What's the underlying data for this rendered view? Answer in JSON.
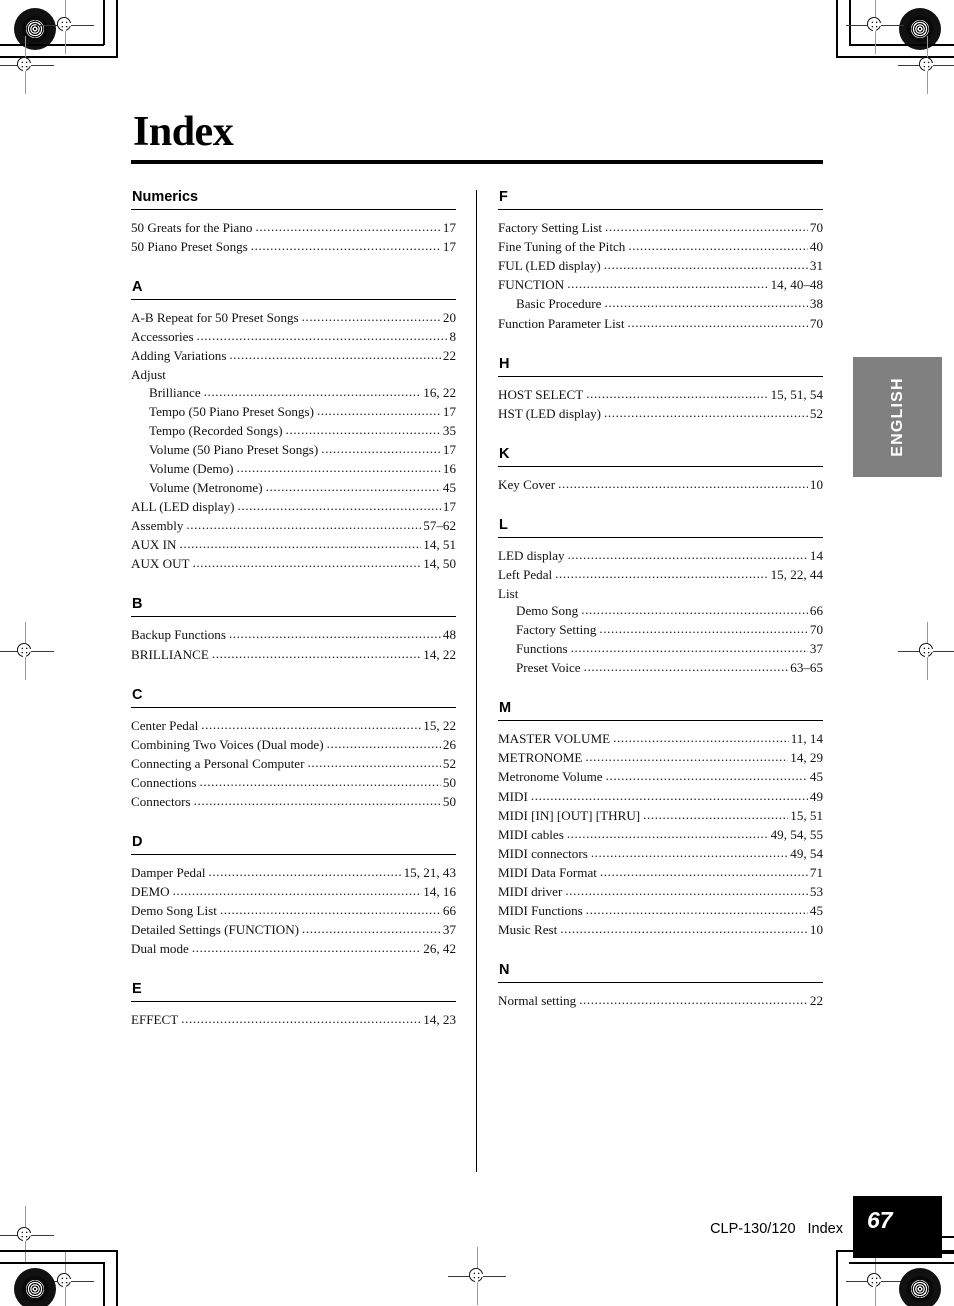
{
  "document": {
    "title": "Index",
    "language_tab": "ENGLISH",
    "footer": {
      "model": "CLP-130/120",
      "section": "Index",
      "page_number": "67"
    }
  },
  "columns": [
    {
      "id": "left",
      "sections": [
        {
          "letter": "Numerics",
          "entries": [
            {
              "text": "50 Greats for the Piano",
              "page": "17",
              "sub": false
            },
            {
              "text": "50 Piano Preset Songs",
              "page": "17",
              "sub": false
            }
          ]
        },
        {
          "letter": "A",
          "entries": [
            {
              "text": "A-B Repeat for 50 Preset Songs",
              "page": "20",
              "sub": false
            },
            {
              "text": "Accessories",
              "page": "8",
              "sub": false
            },
            {
              "text": "Adding Variations",
              "page": "22",
              "sub": false
            },
            {
              "text": "Adjust",
              "page": "",
              "sub": false
            },
            {
              "text": "Brilliance",
              "page": "16, 22",
              "sub": true
            },
            {
              "text": "Tempo (50 Piano Preset Songs)",
              "page": "17",
              "sub": true
            },
            {
              "text": "Tempo (Recorded Songs)",
              "page": "35",
              "sub": true
            },
            {
              "text": "Volume (50 Piano Preset Songs)",
              "page": "17",
              "sub": true
            },
            {
              "text": "Volume (Demo)",
              "page": "16",
              "sub": true
            },
            {
              "text": "Volume (Metronome)",
              "page": "45",
              "sub": true
            },
            {
              "text": "ALL (LED display)",
              "page": "17",
              "sub": false
            },
            {
              "text": "Assembly",
              "page": "57–62",
              "sub": false
            },
            {
              "text": "AUX IN",
              "page": "14, 51",
              "sub": false
            },
            {
              "text": "AUX OUT",
              "page": "14, 50",
              "sub": false
            }
          ]
        },
        {
          "letter": "B",
          "entries": [
            {
              "text": "Backup Functions",
              "page": "48",
              "sub": false
            },
            {
              "text": "BRILLIANCE",
              "page": "14, 22",
              "sub": false
            }
          ]
        },
        {
          "letter": "C",
          "entries": [
            {
              "text": "Center Pedal",
              "page": "15, 22",
              "sub": false
            },
            {
              "text": "Combining Two Voices (Dual mode)",
              "page": "26",
              "sub": false
            },
            {
              "text": "Connecting a Personal Computer",
              "page": "52",
              "sub": false
            },
            {
              "text": "Connections",
              "page": "50",
              "sub": false
            },
            {
              "text": "Connectors",
              "page": "50",
              "sub": false
            }
          ]
        },
        {
          "letter": "D",
          "entries": [
            {
              "text": "Damper Pedal",
              "page": "15, 21, 43",
              "sub": false
            },
            {
              "text": "DEMO",
              "page": "14, 16",
              "sub": false
            },
            {
              "text": "Demo Song List",
              "page": "66",
              "sub": false
            },
            {
              "text": "Detailed Settings (FUNCTION)",
              "page": "37",
              "sub": false
            },
            {
              "text": "Dual mode",
              "page": "26, 42",
              "sub": false
            }
          ]
        },
        {
          "letter": "E",
          "entries": [
            {
              "text": "EFFECT",
              "page": "14, 23",
              "sub": false
            }
          ]
        }
      ]
    },
    {
      "id": "right",
      "sections": [
        {
          "letter": "F",
          "entries": [
            {
              "text": "Factory Setting List",
              "page": "70",
              "sub": false
            },
            {
              "text": "Fine Tuning of the Pitch",
              "page": "40",
              "sub": false
            },
            {
              "text": "FUL (LED display)",
              "page": "31",
              "sub": false
            },
            {
              "text": "FUNCTION",
              "page": "14, 40–48",
              "sub": false
            },
            {
              "text": "Basic Procedure",
              "page": "38",
              "sub": true
            },
            {
              "text": "Function Parameter List",
              "page": "70",
              "sub": false
            }
          ]
        },
        {
          "letter": "H",
          "entries": [
            {
              "text": "HOST SELECT",
              "page": "15, 51, 54",
              "sub": false
            },
            {
              "text": "HST (LED display)",
              "page": "52",
              "sub": false
            }
          ]
        },
        {
          "letter": "K",
          "entries": [
            {
              "text": "Key Cover",
              "page": "10",
              "sub": false
            }
          ]
        },
        {
          "letter": "L",
          "entries": [
            {
              "text": "LED display",
              "page": "14",
              "sub": false
            },
            {
              "text": "Left Pedal",
              "page": "15, 22, 44",
              "sub": false
            },
            {
              "text": "List",
              "page": "",
              "sub": false
            },
            {
              "text": "Demo Song",
              "page": "66",
              "sub": true
            },
            {
              "text": "Factory Setting",
              "page": "70",
              "sub": true
            },
            {
              "text": "Functions",
              "page": "37",
              "sub": true
            },
            {
              "text": "Preset Voice",
              "page": "63–65",
              "sub": true
            }
          ]
        },
        {
          "letter": "M",
          "entries": [
            {
              "text": "MASTER VOLUME",
              "page": "11, 14",
              "sub": false
            },
            {
              "text": "METRONOME",
              "page": "14, 29",
              "sub": false
            },
            {
              "text": "Metronome Volume",
              "page": "45",
              "sub": false
            },
            {
              "text": "MIDI",
              "page": "49",
              "sub": false
            },
            {
              "text": "MIDI [IN] [OUT] [THRU]",
              "page": "15, 51",
              "sub": false
            },
            {
              "text": "MIDI cables",
              "page": "49, 54, 55",
              "sub": false
            },
            {
              "text": "MIDI connectors",
              "page": "49, 54",
              "sub": false
            },
            {
              "text": "MIDI Data Format",
              "page": "71",
              "sub": false
            },
            {
              "text": "MIDI driver",
              "page": "53",
              "sub": false
            },
            {
              "text": "MIDI Functions",
              "page": "45",
              "sub": false
            },
            {
              "text": "Music Rest",
              "page": "10",
              "sub": false
            }
          ]
        },
        {
          "letter": "N",
          "entries": [
            {
              "text": "Normal setting",
              "page": "22",
              "sub": false
            }
          ]
        }
      ]
    }
  ],
  "print_marks": {
    "registration_icon": "registration-target-icon",
    "moire_icon": "density-patch-icon"
  }
}
